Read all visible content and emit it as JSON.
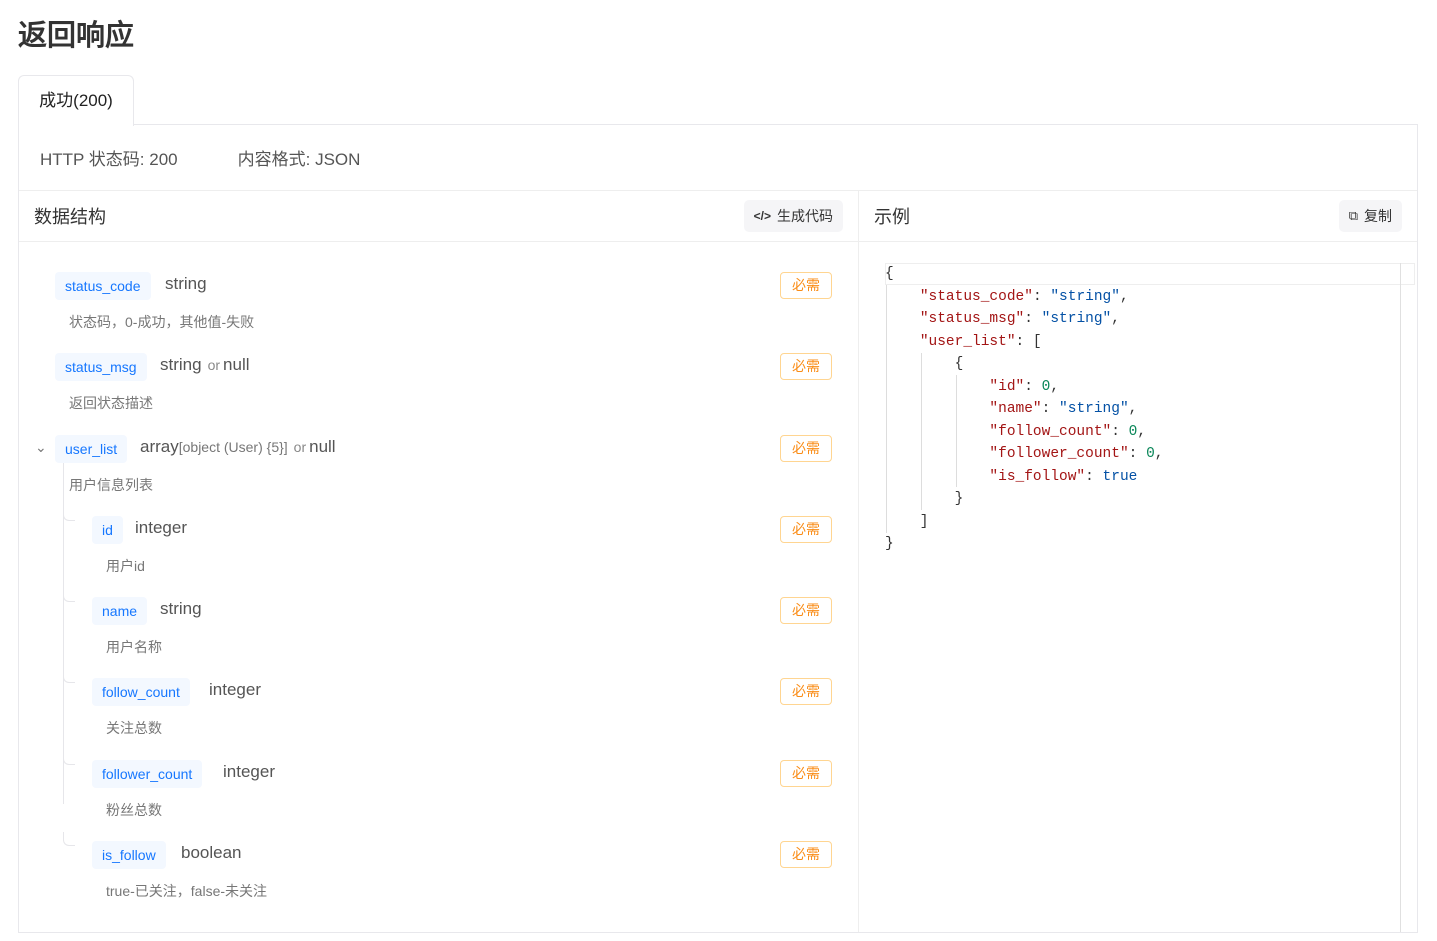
{
  "title": "返回响应",
  "tab": "成功(200)",
  "meta": {
    "status": "HTTP 状态码: 200",
    "format": "内容格式: JSON"
  },
  "left": {
    "header": "数据结构",
    "gen_code": "生成代码"
  },
  "right": {
    "header": "示例",
    "copy": "复制"
  },
  "required_label": "必需",
  "fields": [
    {
      "name": "status_code",
      "type": "string",
      "desc": "状态码，0-成功，其他值-失败"
    },
    {
      "name": "status_msg",
      "type": "string",
      "or": "or",
      "null": "null",
      "desc": "返回状态描述"
    },
    {
      "name": "user_list",
      "type": "array",
      "sub": "[object (User) {5}]",
      "or": "or",
      "null": "null",
      "desc": "用户信息列表"
    },
    {
      "name": "id",
      "type": "integer",
      "desc": "用户id"
    },
    {
      "name": "name",
      "type": "string",
      "desc": "用户名称"
    },
    {
      "name": "follow_count",
      "type": "integer",
      "desc": "关注总数"
    },
    {
      "name": "follower_count",
      "type": "integer",
      "desc": "粉丝总数"
    },
    {
      "name": "is_follow",
      "type": "boolean",
      "desc": "true-已关注，false-未关注"
    }
  ],
  "example": {
    "status_code": "\"string\"",
    "status_msg": "\"string\"",
    "id": "0",
    "name": "\"string\"",
    "follow_count": "0",
    "follower_count": "0",
    "is_follow": "true"
  }
}
